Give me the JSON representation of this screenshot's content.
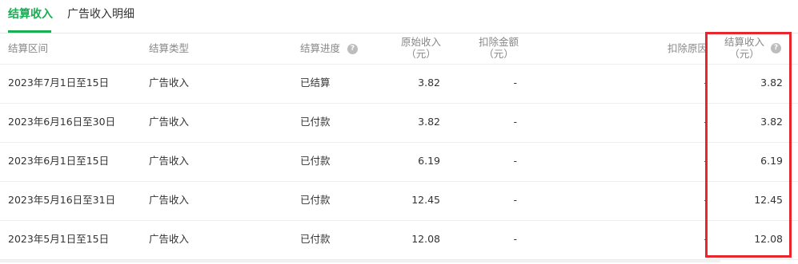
{
  "tabs": [
    {
      "label": "结算收入",
      "active": true
    },
    {
      "label": "广告收入明细",
      "active": false
    }
  ],
  "table": {
    "headers": {
      "period": "结算区间",
      "type": "结算类型",
      "progress": "结算进度",
      "original_l1": "原始收入",
      "original_l2": "（元）",
      "deduct_l1": "扣除金额",
      "deduct_l2": "（元）",
      "reason": "扣除原因",
      "settled_l1": "结算收入",
      "settled_l2": "（元）"
    },
    "help_glyph": "?",
    "rows": [
      {
        "period": "2023年7月1日至15日",
        "type": "广告收入",
        "progress": "已结算",
        "original": "3.82",
        "deduct": "-",
        "reason": "-",
        "settled": "3.82"
      },
      {
        "period": "2023年6月16日至30日",
        "type": "广告收入",
        "progress": "已付款",
        "original": "3.82",
        "deduct": "-",
        "reason": "-",
        "settled": "3.82"
      },
      {
        "period": "2023年6月1日至15日",
        "type": "广告收入",
        "progress": "已付款",
        "original": "6.19",
        "deduct": "-",
        "reason": "-",
        "settled": "6.19"
      },
      {
        "period": "2023年5月16日至31日",
        "type": "广告收入",
        "progress": "已付款",
        "original": "12.45",
        "deduct": "-",
        "reason": "-",
        "settled": "12.45"
      },
      {
        "period": "2023年5月1日至15日",
        "type": "广告收入",
        "progress": "已付款",
        "original": "12.08",
        "deduct": "-",
        "reason": "-",
        "settled": "12.08"
      }
    ]
  },
  "colors": {
    "accent": "#1aad53",
    "highlight": "#e8262b"
  }
}
